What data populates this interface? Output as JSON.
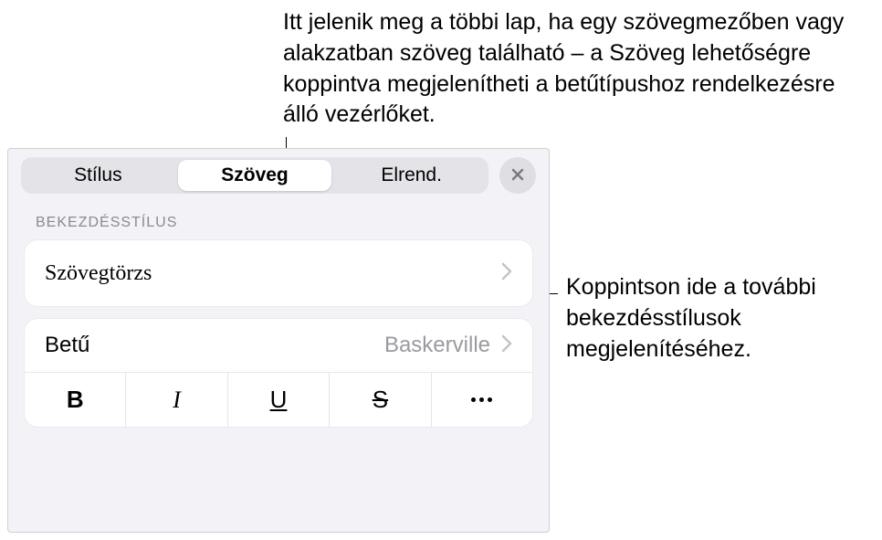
{
  "callouts": {
    "top": "Itt jelenik meg a többi lap, ha egy szövegmezőben vagy alakzatban szöveg található – a Szöveg lehetőségre koppintva megjelenítheti a betűtípushoz rendelkezésre álló vezérlőket.",
    "right": "Koppintson ide a további bekezdésstílusok megjelenítéséhez."
  },
  "tabs": {
    "style": "Stílus",
    "text": "Szöveg",
    "arrange": "Elrend."
  },
  "sections": {
    "paragraphStyle": "BEKEZDÉSSTÍLUS"
  },
  "paragraph": {
    "body": "Szövegtörzs"
  },
  "font": {
    "label": "Betű",
    "value": "Baskerville"
  },
  "styleButtons": {
    "bold": "B",
    "italic": "I",
    "underline": "U",
    "strike": "S"
  }
}
